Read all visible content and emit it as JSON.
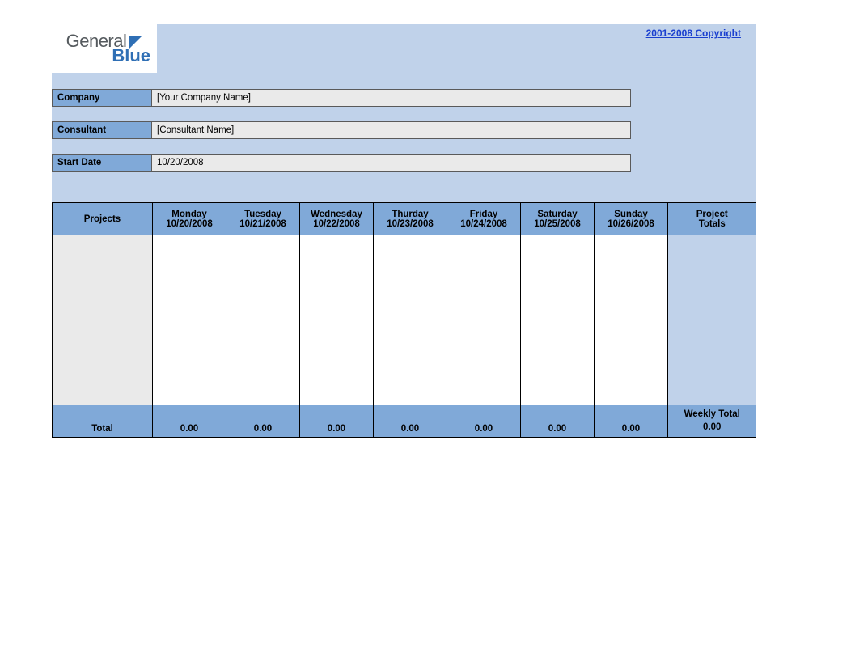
{
  "logo": {
    "word1": "General",
    "word2": "Blue"
  },
  "copyright_link": "2001-2008 Copyright",
  "info": {
    "company_label": "Company",
    "company_value": "[Your Company Name]",
    "consultant_label": "Consultant",
    "consultant_value": "[Consultant Name]",
    "startdate_label": "Start Date",
    "startdate_value": "10/20/2008"
  },
  "headers": {
    "projects": "Projects",
    "days": [
      {
        "name": "Monday",
        "date": "10/20/2008"
      },
      {
        "name": "Tuesday",
        "date": "10/21/2008"
      },
      {
        "name": "Wednesday",
        "date": "10/22/2008"
      },
      {
        "name": "Thurday",
        "date": "10/23/2008"
      },
      {
        "name": "Friday",
        "date": "10/24/2008"
      },
      {
        "name": "Saturday",
        "date": "10/25/2008"
      },
      {
        "name": "Sunday",
        "date": "10/26/2008"
      }
    ],
    "project_totals_l1": "Project",
    "project_totals_l2": "Totals"
  },
  "rows": [
    {
      "project": "",
      "d0": "",
      "d1": "",
      "d2": "",
      "d3": "",
      "d4": "",
      "d5": "",
      "d6": ""
    },
    {
      "project": "",
      "d0": "",
      "d1": "",
      "d2": "",
      "d3": "",
      "d4": "",
      "d5": "",
      "d6": ""
    },
    {
      "project": "",
      "d0": "",
      "d1": "",
      "d2": "",
      "d3": "",
      "d4": "",
      "d5": "",
      "d6": ""
    },
    {
      "project": "",
      "d0": "",
      "d1": "",
      "d2": "",
      "d3": "",
      "d4": "",
      "d5": "",
      "d6": ""
    },
    {
      "project": "",
      "d0": "",
      "d1": "",
      "d2": "",
      "d3": "",
      "d4": "",
      "d5": "",
      "d6": ""
    },
    {
      "project": "",
      "d0": "",
      "d1": "",
      "d2": "",
      "d3": "",
      "d4": "",
      "d5": "",
      "d6": ""
    },
    {
      "project": "",
      "d0": "",
      "d1": "",
      "d2": "",
      "d3": "",
      "d4": "",
      "d5": "",
      "d6": ""
    },
    {
      "project": "",
      "d0": "",
      "d1": "",
      "d2": "",
      "d3": "",
      "d4": "",
      "d5": "",
      "d6": ""
    },
    {
      "project": "",
      "d0": "",
      "d1": "",
      "d2": "",
      "d3": "",
      "d4": "",
      "d5": "",
      "d6": ""
    },
    {
      "project": "",
      "d0": "",
      "d1": "",
      "d2": "",
      "d3": "",
      "d4": "",
      "d5": "",
      "d6": ""
    }
  ],
  "totals": {
    "label": "Total",
    "d0": "0.00",
    "d1": "0.00",
    "d2": "0.00",
    "d3": "0.00",
    "d4": "0.00",
    "d5": "0.00",
    "d6": "0.00",
    "weekly_label": "Weekly Total",
    "weekly_value": "0.00"
  }
}
